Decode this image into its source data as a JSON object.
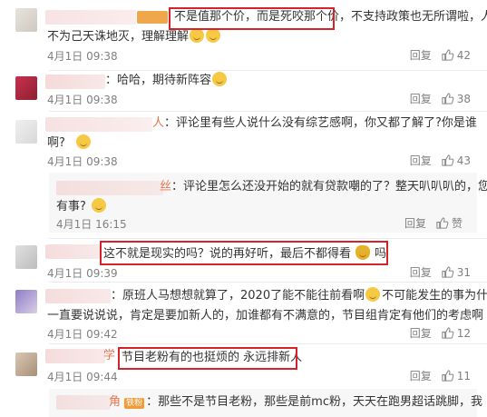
{
  "comments": [
    {
      "badge": "",
      "text_main": "不是值那个价，而是死咬那个价，",
      "text_rest": "不支持政策也无所谓啦，人",
      "text_line2": "不为己天诛地灭，理解理解",
      "time": "4月1日 09:38",
      "reply": "回复",
      "likes": "42"
    },
    {
      "text": "：哈哈，期待新阵容",
      "time": "4月1日 09:38",
      "reply": "回复",
      "likes": "38"
    },
    {
      "name_suffix": "人",
      "text": "：评论里有些人说什么没有综艺感啊，你又都了解了?你是谁",
      "text_line2": "啊?",
      "time": "4月1日 09:38",
      "reply": "回复",
      "likes": "43"
    },
    {
      "name_suffix": "丝",
      "text": "：评论里怎么还没开始的就有贷款嘲的了？整天叭叭叭的，您",
      "text_line2": "有事?",
      "time": "4月1日 16:15",
      "reply": "回复",
      "likes": "赞"
    },
    {
      "text": "这不就是现实的吗？说的再好听，最后不都得看",
      "text_tail": "吗",
      "time": "4月1日 09:39",
      "reply": "回复",
      "likes": "31"
    },
    {
      "text": "：原班人马想想就算了，2020了能不能往前看啊",
      "text_rest": "不可能发生的事为什么",
      "text_line2": "一直要说说说，肯定是要加新人的，加谁都有不满意的，节目组肯定有他们的考虑啊",
      "time": "4月1日 09:42",
      "reply": "回复",
      "likes": "12"
    },
    {
      "name_suffix": "学",
      "text": "节目老粉有的也挺烦的 永远排新人",
      "time": "4月1日 09:44",
      "reply": "回复",
      "likes": "11"
    },
    {
      "name_suffix": "角",
      "badge": "铁粉",
      "text": "：那些不是节目老粉，那些是前mc粉，天天在跑男超话跳脚，我"
    }
  ]
}
